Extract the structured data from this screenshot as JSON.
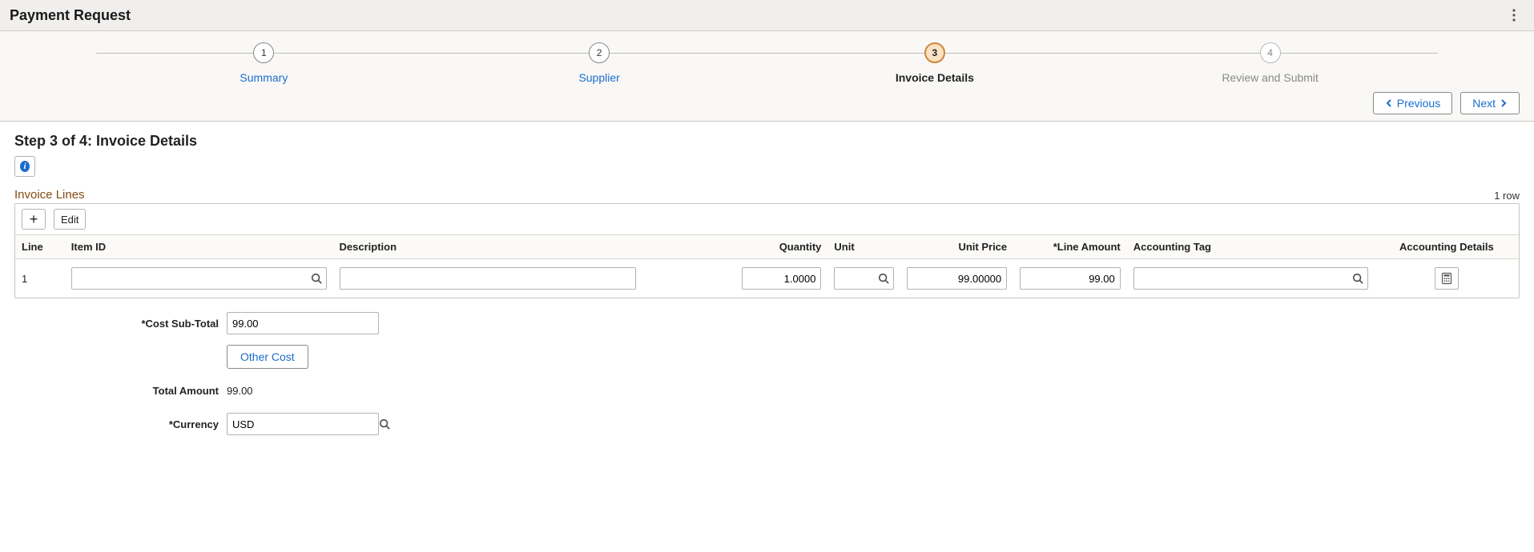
{
  "header": {
    "title": "Payment Request"
  },
  "wizard": {
    "steps": [
      {
        "num": "1",
        "label": "Summary"
      },
      {
        "num": "2",
        "label": "Supplier"
      },
      {
        "num": "3",
        "label": "Invoice Details"
      },
      {
        "num": "4",
        "label": "Review and Submit"
      }
    ],
    "prev_label": "Previous",
    "next_label": "Next"
  },
  "step": {
    "title": "Step 3 of 4: Invoice Details"
  },
  "invoice_lines": {
    "section_title": "Invoice Lines",
    "row_count_text": "1 row",
    "edit_label": "Edit",
    "columns": {
      "line": "Line",
      "item_id": "Item ID",
      "description": "Description",
      "quantity": "Quantity",
      "unit": "Unit",
      "unit_price": "Unit Price",
      "line_amount": "*Line Amount",
      "accounting_tag": "Accounting Tag",
      "accounting_details": "Accounting Details"
    },
    "rows": [
      {
        "line": "1",
        "item_id": "",
        "description": "",
        "quantity": "1.0000",
        "unit": "",
        "unit_price": "99.00000",
        "line_amount": "99.00",
        "accounting_tag": ""
      }
    ]
  },
  "totals": {
    "cost_subtotal_label": "*Cost Sub-Total",
    "cost_subtotal_value": "99.00",
    "other_cost_label": "Other Cost",
    "total_amount_label": "Total Amount",
    "total_amount_value": "99.00",
    "currency_label": "*Currency",
    "currency_value": "USD"
  }
}
